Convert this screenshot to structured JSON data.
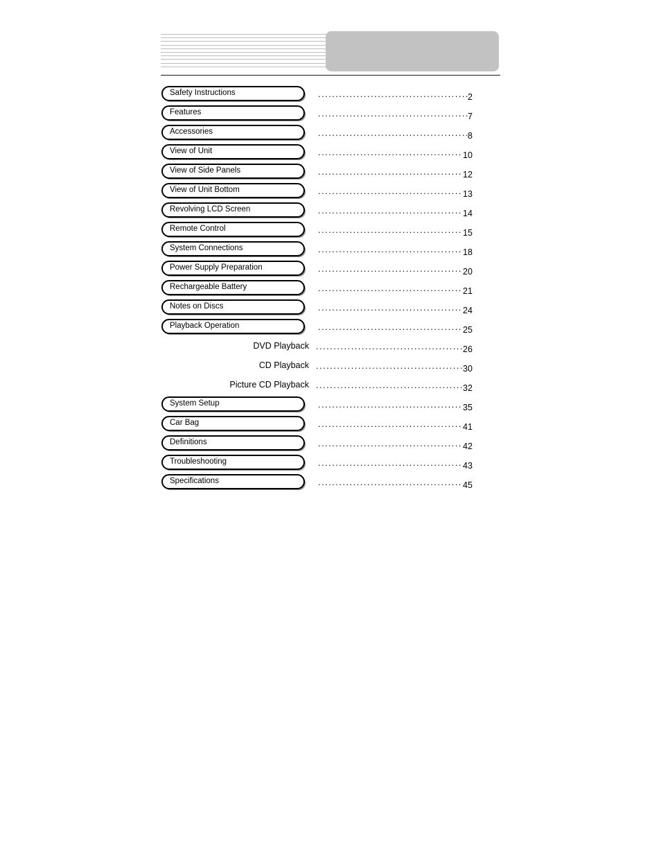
{
  "document": {
    "page_background": "#ffffff",
    "header": {
      "decorative_line_count": 10,
      "line_color": "#bdbdbd",
      "title_box_color": "#c2c2c2",
      "title_box_text": "",
      "rule_color": "#1a1a1a"
    }
  },
  "toc": {
    "entries": [
      {
        "label": "Safety Instructions",
        "page": "2",
        "style": "boxed"
      },
      {
        "label": "Features",
        "page": "7",
        "style": "boxed"
      },
      {
        "label": "Accessories",
        "page": "8",
        "style": "boxed"
      },
      {
        "label": "View of Unit",
        "page": "10",
        "style": "boxed"
      },
      {
        "label": "View of Side Panels",
        "page": "12",
        "style": "boxed"
      },
      {
        "label": "View of Unit Bottom",
        "page": "13",
        "style": "boxed"
      },
      {
        "label": "Revolving LCD Screen",
        "page": "14",
        "style": "boxed"
      },
      {
        "label": "Remote Control",
        "page": "15",
        "style": "boxed"
      },
      {
        "label": "System Connections",
        "page": "18",
        "style": "boxed"
      },
      {
        "label": "Power Supply Preparation",
        "page": "20",
        "style": "boxed"
      },
      {
        "label": "Rechargeable Battery",
        "page": "21",
        "style": "boxed"
      },
      {
        "label": "Notes on Discs",
        "page": "24",
        "style": "boxed"
      },
      {
        "label": "Playback Operation",
        "page": "25",
        "style": "boxed"
      },
      {
        "label": "DVD Playback",
        "page": "26",
        "style": "sub"
      },
      {
        "label": "CD Playback",
        "page": "30",
        "style": "sub"
      },
      {
        "label": "Picture CD Playback",
        "page": "32",
        "style": "sub"
      },
      {
        "label": "System Setup",
        "page": "35",
        "style": "boxed"
      },
      {
        "label": "Car Bag",
        "page": "41",
        "style": "boxed"
      },
      {
        "label": "Definitions",
        "page": "42",
        "style": "boxed"
      },
      {
        "label": "Troubleshooting",
        "page": "43",
        "style": "boxed"
      },
      {
        "label": "Specifications",
        "page": "45",
        "style": "boxed"
      }
    ]
  }
}
